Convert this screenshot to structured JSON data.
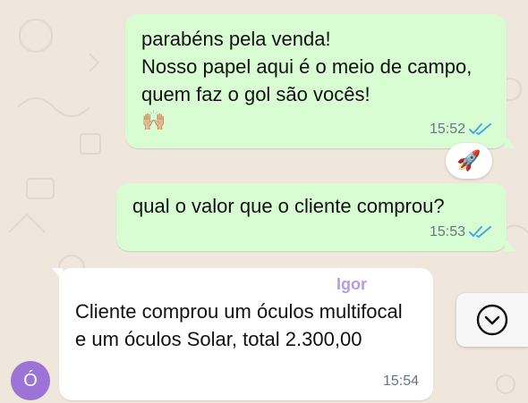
{
  "colors": {
    "outgoing_bubble": "#d9fdd3",
    "incoming_bubble": "#ffffff",
    "read_ticks": "#4aa8e0",
    "sender_name": "#b59be6",
    "avatar": "#9b74d6",
    "wallpaper": "#efe7dc"
  },
  "messages": [
    {
      "direction": "outgoing",
      "text": "parabéns pela venda!\nNosso papel aqui é o meio de campo, quem faz o gol são vocês!",
      "emoji": "🙌🏼",
      "time": "15:52",
      "status_icon": "double-check-read-icon"
    },
    {
      "direction": "outgoing",
      "text": "qual o valor que o cliente comprou?",
      "time": "15:53",
      "status_icon": "double-check-read-icon"
    },
    {
      "direction": "incoming",
      "sender": "Igor",
      "text": "Cliente comprou um óculos multifocal e um óculos Solar, total 2.300,00",
      "time": "15:54"
    }
  ],
  "reaction": {
    "emoji": "🚀",
    "icon": "rocket-icon"
  },
  "scroll_down": {
    "icon": "chevron-down-icon"
  },
  "avatar": {
    "initial": "Ó"
  }
}
